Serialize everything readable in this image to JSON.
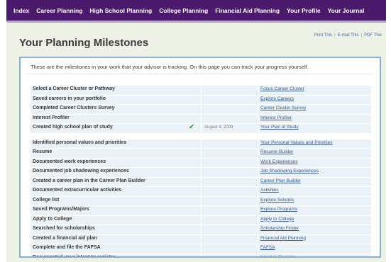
{
  "nav": {
    "items": [
      "Index",
      "Career Planning",
      "High School Planning",
      "College Planning",
      "Financial Aid Planning",
      "Your Profile",
      "Your Journal"
    ]
  },
  "util_links": {
    "print": "Print This",
    "email": "E-mail This",
    "pdf": "PDF This",
    "separator": "|"
  },
  "title": "Your Planning Milestones",
  "intro": "These are the milestones in your work that your advisor is tracking. On this page you can track your progress yourself.",
  "milestones": [
    {
      "label": "Select a Career Cluster or Pathway",
      "link": "Focus Career Cluster",
      "completed": false,
      "date": ""
    },
    {
      "label": "Saved careers in your portfolio",
      "link": "Explore Careers",
      "completed": false,
      "date": ""
    },
    {
      "label": "Completed Career Clusters Survey",
      "link": "Career Cluster Survey",
      "completed": false,
      "date": ""
    },
    {
      "label": "Interest Profiler",
      "link": "Interest Profiler",
      "completed": false,
      "date": ""
    },
    {
      "label": "Created high school plan of study",
      "link": "Your Plan of Study",
      "completed": true,
      "date": "August 4, 2009"
    },
    {
      "label": "Identified personal values and priorities",
      "link": "Your Personal Values and Priorities",
      "completed": false,
      "date": ""
    },
    {
      "label": "Resume",
      "link": "Resume Builder",
      "completed": false,
      "date": ""
    },
    {
      "label": "Documented work experiences",
      "link": "Work Experiences",
      "completed": false,
      "date": ""
    },
    {
      "label": "Documented job shadowing experiences",
      "link": "Job Shadowing Experiences",
      "completed": false,
      "date": ""
    },
    {
      "label": "Created a career plan in the Career Plan Builder",
      "link": "Career Plan Builder",
      "completed": false,
      "date": ""
    },
    {
      "label": "Documented extracurricular activities",
      "link": "Activities",
      "completed": false,
      "date": ""
    },
    {
      "label": "College list",
      "link": "Explore Schools",
      "completed": false,
      "date": ""
    },
    {
      "label": "Saved Programs/Majors",
      "link": "Explore Programs",
      "completed": false,
      "date": ""
    },
    {
      "label": "Apply to College",
      "link": "Apply to College",
      "completed": false,
      "date": ""
    },
    {
      "label": "Searched for scholarships",
      "link": "Scholarship Finder",
      "completed": false,
      "date": ""
    },
    {
      "label": "Created a financial aid plan",
      "link": "Financial Aid Planning",
      "completed": false,
      "date": ""
    },
    {
      "label": "Complete and file the FAFSA",
      "link": "FAFSA",
      "completed": false,
      "date": ""
    },
    {
      "label": "Documented your intent to register",
      "link": "Intent to Register",
      "completed": false,
      "date": ""
    }
  ],
  "check_icon": "✔",
  "colors": {
    "nav_bg": "#4b1a6c",
    "panel_border": "#8ab0cf",
    "row_bg": "#eaf2f8",
    "link": "#3a5a8a",
    "check": "#2e9a4a"
  }
}
